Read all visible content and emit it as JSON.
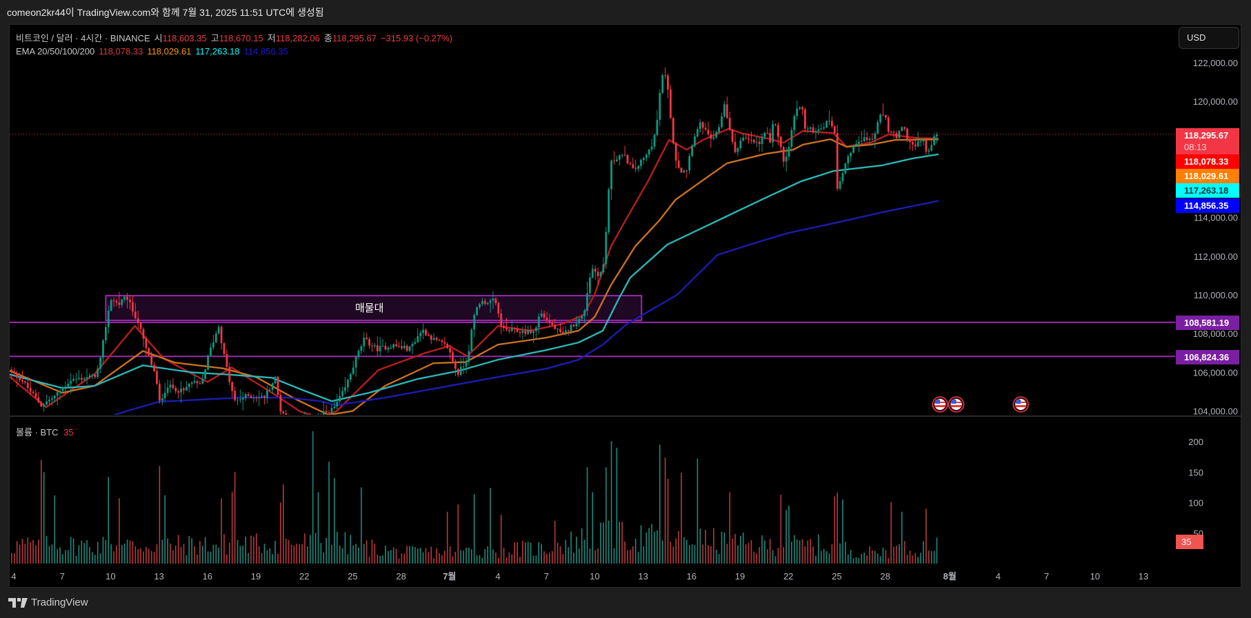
{
  "header": {
    "caption": "comeon2kr44이 TradingView.com와 함께 7월 31, 2025 11:51 UTC에 생성됨"
  },
  "legend": {
    "symbol": "비트코인 / 달러 · 4시간 · BINANCE",
    "open_label": "시",
    "open": "118,603.35",
    "high_label": "고",
    "high": "118,670.15",
    "low_label": "저",
    "low": "118,282.06",
    "close_label": "종",
    "close": "118,295.67",
    "change": "−315.93 (−0.27%)",
    "ema_label": "EMA 20/50/100/200",
    "ema20": "118,078.33",
    "ema50": "118,029.61",
    "ema100": "117,263.18",
    "ema200": "114,856.35"
  },
  "currency_button": "USD",
  "price_tags": {
    "last": "118,295.67",
    "countdown": "08:13",
    "ema20": "118,078.33",
    "ema50": "118,029.61",
    "ema100": "117,263.18",
    "ema200": "114,856.35",
    "level1": "108,581.19",
    "level2": "106,824.36"
  },
  "volume": {
    "label": "볼륨 · BTC",
    "value": "35",
    "tag": "35"
  },
  "zone_label": "매물대",
  "footer": {
    "brand": "TradingView"
  },
  "colors": {
    "up": "#089981",
    "down": "#f23645",
    "ema20": "#b81d1d",
    "ema50": "#c9701f",
    "ema100": "#2bb5b5",
    "ema200": "#1c1cb0",
    "zone": "#9c27b0"
  },
  "chart_data": {
    "type": "candlestick",
    "title": "비트코인 / 달러 · 4시간 · BINANCE",
    "x_unit": "days since Jun 4 2025",
    "x_ticks": [
      {
        "label": "4",
        "day": 0
      },
      {
        "label": "7",
        "day": 3
      },
      {
        "label": "10",
        "day": 6
      },
      {
        "label": "13",
        "day": 9
      },
      {
        "label": "16",
        "day": 12
      },
      {
        "label": "19",
        "day": 15
      },
      {
        "label": "22",
        "day": 18
      },
      {
        "label": "25",
        "day": 21
      },
      {
        "label": "28",
        "day": 24
      },
      {
        "label": "7월",
        "day": 27
      },
      {
        "label": "4",
        "day": 30
      },
      {
        "label": "7",
        "day": 33
      },
      {
        "label": "10",
        "day": 36
      },
      {
        "label": "13",
        "day": 39
      },
      {
        "label": "16",
        "day": 42
      },
      {
        "label": "19",
        "day": 45
      },
      {
        "label": "22",
        "day": 48
      },
      {
        "label": "25",
        "day": 51
      },
      {
        "label": "28",
        "day": 54
      },
      {
        "label": "8월",
        "day": 58
      },
      {
        "label": "4",
        "day": 61
      },
      {
        "label": "7",
        "day": 64
      },
      {
        "label": "10",
        "day": 67
      },
      {
        "label": "13",
        "day": 70
      }
    ],
    "y_ticks": [
      {
        "label": "122,000.00",
        "value": 122000
      },
      {
        "label": "120,000.00",
        "value": 120000
      },
      {
        "label": "114,000.00",
        "value": 114000
      },
      {
        "label": "112,000.00",
        "value": 112000
      },
      {
        "label": "110,000.00",
        "value": 110000
      },
      {
        "label": "108,000.00",
        "value": 108000
      },
      {
        "label": "106,000.00",
        "value": 106000
      },
      {
        "label": "104,000.00",
        "value": 104000
      }
    ],
    "y_range": [
      103700,
      124000
    ],
    "last_price": 118295.67,
    "close_path": [
      [
        -0.3,
        106100
      ],
      [
        0.5,
        105600
      ],
      [
        1,
        105050
      ],
      [
        1.7,
        104300
      ],
      [
        2.6,
        104800
      ],
      [
        3.5,
        105600
      ],
      [
        5,
        105800
      ],
      [
        5.3,
        106300
      ],
      [
        5.7,
        108400
      ],
      [
        6,
        109800
      ],
      [
        6.5,
        109500
      ],
      [
        7,
        109900
      ],
      [
        7.3,
        109300
      ],
      [
        7.7,
        108600
      ],
      [
        8.2,
        107200
      ],
      [
        8.8,
        105800
      ],
      [
        9,
        104400
      ],
      [
        9.5,
        105300
      ],
      [
        10.5,
        105000
      ],
      [
        11,
        105500
      ],
      [
        11.6,
        105300
      ],
      [
        12.1,
        107000
      ],
      [
        12.7,
        108400
      ],
      [
        13,
        107000
      ],
      [
        13.4,
        105400
      ],
      [
        13.7,
        104500
      ],
      [
        14.5,
        104800
      ],
      [
        15.5,
        104700
      ],
      [
        16.2,
        105700
      ],
      [
        16.5,
        104100
      ],
      [
        17,
        103600
      ],
      [
        18,
        103500
      ],
      [
        19,
        103800
      ],
      [
        19.8,
        104100
      ],
      [
        20.5,
        105100
      ],
      [
        21.2,
        106700
      ],
      [
        21.7,
        107700
      ],
      [
        22.5,
        107200
      ],
      [
        23.5,
        107400
      ],
      [
        24.5,
        107200
      ],
      [
        25.3,
        108200
      ],
      [
        26,
        107700
      ],
      [
        26.9,
        107300
      ],
      [
        27.5,
        105900
      ],
      [
        28.1,
        106700
      ],
      [
        28.5,
        108800
      ],
      [
        28.8,
        109600
      ],
      [
        29.8,
        109700
      ],
      [
        30.3,
        108200
      ],
      [
        31.5,
        108100
      ],
      [
        32.3,
        108100
      ],
      [
        32.6,
        109100
      ],
      [
        33.5,
        108300
      ],
      [
        34,
        107900
      ],
      [
        34.7,
        108500
      ],
      [
        35.3,
        108900
      ],
      [
        35.6,
        110500
      ],
      [
        35.8,
        111400
      ],
      [
        36.3,
        111000
      ],
      [
        36.6,
        111700
      ],
      [
        36.8,
        114800
      ],
      [
        37,
        116800
      ],
      [
        37.5,
        117200
      ],
      [
        37.9,
        117100
      ],
      [
        38.4,
        116400
      ],
      [
        39.2,
        117200
      ],
      [
        39.5,
        117700
      ],
      [
        39.8,
        118500
      ],
      [
        40,
        120000
      ],
      [
        40.1,
        121300
      ],
      [
        40.5,
        121200
      ],
      [
        40.6,
        119700
      ],
      [
        41,
        117100
      ],
      [
        41.3,
        116400
      ],
      [
        41.7,
        116500
      ],
      [
        42.1,
        118100
      ],
      [
        42.6,
        118900
      ],
      [
        43,
        118200
      ],
      [
        43.4,
        118000
      ],
      [
        43.8,
        118900
      ],
      [
        44,
        120000
      ],
      [
        44.2,
        119200
      ],
      [
        44.5,
        117900
      ],
      [
        44.7,
        117400
      ],
      [
        45.1,
        118100
      ],
      [
        45.8,
        117900
      ],
      [
        46.2,
        117800
      ],
      [
        46.6,
        118500
      ],
      [
        46.9,
        117700
      ],
      [
        47.1,
        119200
      ],
      [
        47.4,
        118100
      ],
      [
        47.7,
        116900
      ],
      [
        48,
        117400
      ],
      [
        48.3,
        119100
      ],
      [
        48.8,
        120000
      ],
      [
        49,
        118600
      ],
      [
        49.5,
        118500
      ],
      [
        49.9,
        118600
      ],
      [
        50.3,
        118800
      ],
      [
        50.6,
        119100
      ],
      [
        50.9,
        118200
      ],
      [
        51,
        115500
      ],
      [
        51.3,
        116200
      ],
      [
        51.6,
        117000
      ],
      [
        51.9,
        117400
      ],
      [
        52.2,
        117900
      ],
      [
        52.6,
        118100
      ],
      [
        53.2,
        118000
      ],
      [
        53.7,
        119200
      ],
      [
        54,
        119300
      ],
      [
        54.2,
        118500
      ],
      [
        54.7,
        118100
      ],
      [
        55.1,
        118700
      ],
      [
        55.4,
        118100
      ],
      [
        55.8,
        117600
      ],
      [
        56.4,
        118100
      ],
      [
        56.6,
        117000
      ],
      [
        56.8,
        117700
      ],
      [
        57,
        118200
      ],
      [
        57.15,
        118600
      ],
      [
        57.3,
        118296
      ]
    ],
    "ema": [
      {
        "name": "EMA 20",
        "points": [
          [
            -0.3,
            105800
          ],
          [
            2,
            104200
          ],
          [
            5,
            105900
          ],
          [
            7.5,
            108400
          ],
          [
            9.3,
            106700
          ],
          [
            12,
            105500
          ],
          [
            13.5,
            106250
          ],
          [
            16,
            104940
          ],
          [
            17.7,
            104000
          ],
          [
            19,
            103600
          ],
          [
            20,
            104000
          ],
          [
            22.6,
            106120
          ],
          [
            25.5,
            107000
          ],
          [
            27,
            107360
          ],
          [
            28.1,
            106830
          ],
          [
            30,
            108390
          ],
          [
            32,
            108150
          ],
          [
            34,
            108500
          ],
          [
            35.3,
            108960
          ],
          [
            36,
            110030
          ],
          [
            37,
            112500
          ],
          [
            37.9,
            113840
          ],
          [
            39.3,
            115870
          ],
          [
            40.6,
            118000
          ],
          [
            41.7,
            117500
          ],
          [
            42.7,
            118000
          ],
          [
            44.3,
            118580
          ],
          [
            45.1,
            118350
          ],
          [
            46.6,
            118100
          ],
          [
            47.7,
            117860
          ],
          [
            48.9,
            118470
          ],
          [
            50.8,
            118350
          ],
          [
            51.6,
            117650
          ],
          [
            53.1,
            117860
          ],
          [
            54.2,
            118290
          ],
          [
            56,
            118100
          ],
          [
            57.3,
            118078
          ]
        ]
      },
      {
        "name": "EMA 50",
        "points": [
          [
            -0.3,
            106100
          ],
          [
            3,
            104940
          ],
          [
            5,
            105300
          ],
          [
            8,
            107100
          ],
          [
            10,
            106500
          ],
          [
            13,
            106200
          ],
          [
            15,
            105760
          ],
          [
            17.5,
            104600
          ],
          [
            19.5,
            103800
          ],
          [
            21,
            104000
          ],
          [
            23,
            105300
          ],
          [
            26,
            106470
          ],
          [
            28,
            106530
          ],
          [
            30,
            107430
          ],
          [
            33,
            107790
          ],
          [
            35,
            108150
          ],
          [
            36,
            108860
          ],
          [
            37,
            110500
          ],
          [
            38.5,
            112500
          ],
          [
            40,
            113840
          ],
          [
            41,
            114910
          ],
          [
            42.8,
            115980
          ],
          [
            44.2,
            116800
          ],
          [
            46.6,
            117290
          ],
          [
            48.3,
            117500
          ],
          [
            48.9,
            117760
          ],
          [
            50.6,
            118040
          ],
          [
            51.6,
            117650
          ],
          [
            53.1,
            117760
          ],
          [
            54.6,
            118000
          ],
          [
            57.3,
            118030
          ]
        ]
      },
      {
        "name": "EMA 100",
        "points": [
          [
            -0.3,
            105900
          ],
          [
            3,
            105190
          ],
          [
            5,
            105300
          ],
          [
            8,
            106360
          ],
          [
            11,
            106000
          ],
          [
            13,
            105900
          ],
          [
            16,
            105720
          ],
          [
            18,
            105050
          ],
          [
            19.7,
            104510
          ],
          [
            22,
            104940
          ],
          [
            25,
            105650
          ],
          [
            27.6,
            106080
          ],
          [
            30,
            106650
          ],
          [
            33,
            107150
          ],
          [
            35,
            107540
          ],
          [
            36.5,
            108150
          ],
          [
            37.5,
            109820
          ],
          [
            38.2,
            110890
          ],
          [
            40.5,
            112600
          ],
          [
            43.9,
            113950
          ],
          [
            46.6,
            115020
          ],
          [
            48.8,
            115870
          ],
          [
            50.8,
            116400
          ],
          [
            53.8,
            116690
          ],
          [
            55.7,
            117050
          ],
          [
            57.3,
            117263
          ]
        ]
      },
      {
        "name": "EMA 200",
        "points": [
          [
            5.5,
            103600
          ],
          [
            7,
            104000
          ],
          [
            9,
            104480
          ],
          [
            14,
            104690
          ],
          [
            17,
            104690
          ],
          [
            19,
            104510
          ],
          [
            20,
            104300
          ],
          [
            23,
            104690
          ],
          [
            27,
            105300
          ],
          [
            30,
            105760
          ],
          [
            33,
            106190
          ],
          [
            35,
            106650
          ],
          [
            36.5,
            107430
          ],
          [
            38,
            108500
          ],
          [
            41.1,
            110000
          ],
          [
            43.6,
            112060
          ],
          [
            46,
            112700
          ],
          [
            48,
            113200
          ],
          [
            50.8,
            113700
          ],
          [
            54,
            114300
          ],
          [
            57.3,
            114856
          ]
        ]
      }
    ],
    "horizontal_levels": [
      108581.19,
      106824.36
    ],
    "zone": {
      "label": "매물대",
      "from_day": 5.7,
      "to_day": 38.9,
      "low": 108680,
      "high": 109960
    },
    "events": [
      {
        "type": "US economic event",
        "day": 57.4
      },
      {
        "type": "US economic event",
        "day": 58.4
      },
      {
        "type": "US economic event",
        "day": 62.4
      }
    ],
    "volume": {
      "y_ticks": [
        {
          "label": "200",
          "value": 200
        },
        {
          "label": "150",
          "value": 150
        },
        {
          "label": "100",
          "value": 100
        },
        {
          "label": "50",
          "value": 50
        }
      ],
      "baseline": [
        [
          -0.3,
          30
        ],
        [
          10,
          30
        ],
        [
          20,
          35
        ],
        [
          24,
          18
        ],
        [
          27,
          20
        ],
        [
          33,
          25
        ],
        [
          36,
          45
        ],
        [
          42,
          40
        ],
        [
          46,
          30
        ],
        [
          50,
          30
        ],
        [
          53,
          18
        ],
        [
          57.3,
          30
        ]
      ],
      "spikes": [
        [
          1.7,
          170
        ],
        [
          1.9,
          150
        ],
        [
          2.5,
          112
        ],
        [
          5.9,
          142
        ],
        [
          6.5,
          107
        ],
        [
          9,
          160
        ],
        [
          9.4,
          112
        ],
        [
          13.7,
          150
        ],
        [
          13.5,
          117
        ],
        [
          12.9,
          107
        ],
        [
          16.7,
          130
        ],
        [
          16.5,
          100
        ],
        [
          18.5,
          217
        ],
        [
          19.6,
          167
        ],
        [
          19.8,
          140
        ],
        [
          18.9,
          117
        ],
        [
          21.5,
          125
        ],
        [
          27.5,
          97
        ],
        [
          26.8,
          85
        ],
        [
          28.6,
          114
        ],
        [
          29.5,
          124
        ],
        [
          30.2,
          80
        ],
        [
          33.6,
          70
        ],
        [
          35.6,
          158
        ],
        [
          35.8,
          117
        ],
        [
          36.7,
          158
        ],
        [
          37.1,
          201
        ],
        [
          37.3,
          190
        ],
        [
          40.1,
          195
        ],
        [
          40.3,
          174
        ],
        [
          40.5,
          139
        ],
        [
          41.4,
          149
        ],
        [
          42.4,
          172
        ],
        [
          44.4,
          117
        ],
        [
          47.6,
          113
        ],
        [
          47.8,
          88
        ],
        [
          48.0,
          95
        ],
        [
          51.1,
          116
        ],
        [
          50.9,
          110
        ],
        [
          51.3,
          105
        ],
        [
          54.4,
          101
        ],
        [
          55.1,
          85
        ],
        [
          56.6,
          116
        ],
        [
          56.5,
          90
        ],
        [
          57.3,
          35
        ]
      ]
    }
  }
}
